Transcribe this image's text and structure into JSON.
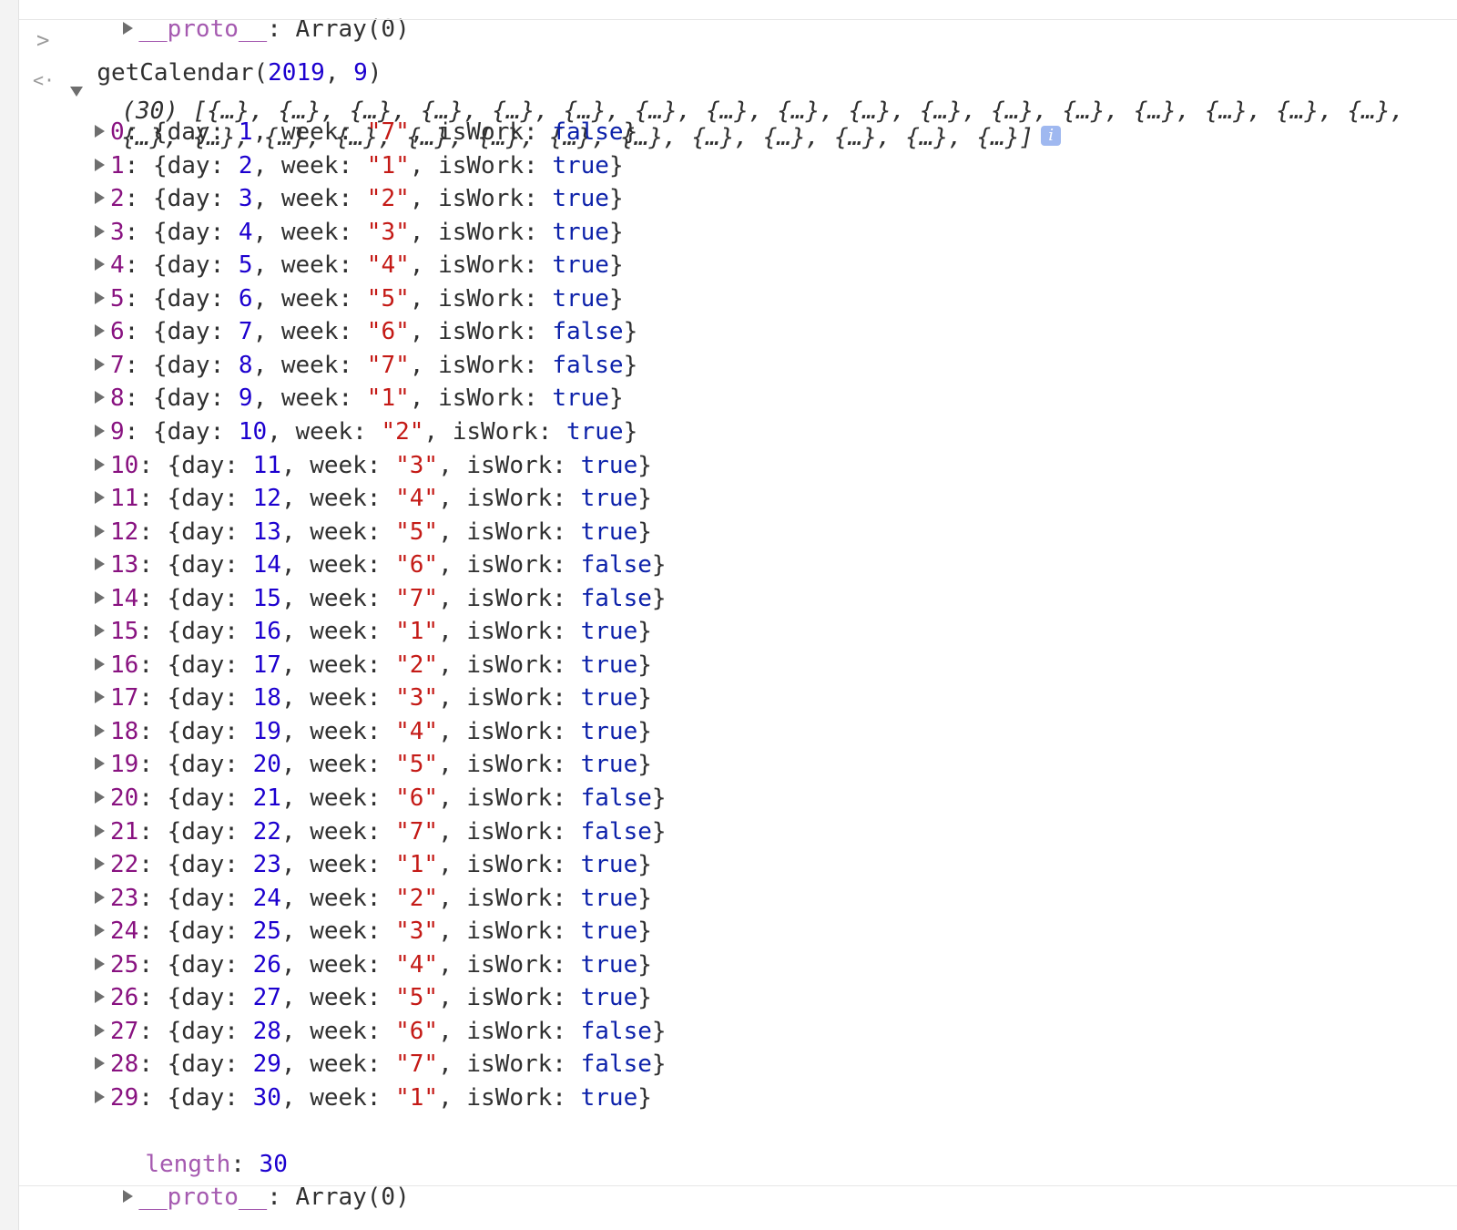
{
  "top_partial": {
    "key": "__proto__",
    "value": "Array(0)"
  },
  "command": {
    "func": "getCalendar(",
    "arg1": "2019",
    "comma": ", ",
    "arg2": "9",
    "close": ")"
  },
  "summary": {
    "count": "(30)",
    "line1": "[{…}, {…}, {…}, {…}, {…}, {…}, {…}, {…}, {…}, {…}, {…}, {…}, {…}, {…}, {…}, {…}, {…},",
    "line2": "{…}, {…}, {…}, {…}, {…}, {…}, {…}, {…}, {…}, {…}, {…}, {…}, {…}]",
    "info_icon": "info-icon"
  },
  "items": [
    {
      "index": "0",
      "day": "1",
      "week": "\"7\"",
      "isWork": "false"
    },
    {
      "index": "1",
      "day": "2",
      "week": "\"1\"",
      "isWork": "true"
    },
    {
      "index": "2",
      "day": "3",
      "week": "\"2\"",
      "isWork": "true"
    },
    {
      "index": "3",
      "day": "4",
      "week": "\"3\"",
      "isWork": "true"
    },
    {
      "index": "4",
      "day": "5",
      "week": "\"4\"",
      "isWork": "true"
    },
    {
      "index": "5",
      "day": "6",
      "week": "\"5\"",
      "isWork": "true"
    },
    {
      "index": "6",
      "day": "7",
      "week": "\"6\"",
      "isWork": "false"
    },
    {
      "index": "7",
      "day": "8",
      "week": "\"7\"",
      "isWork": "false"
    },
    {
      "index": "8",
      "day": "9",
      "week": "\"1\"",
      "isWork": "true"
    },
    {
      "index": "9",
      "day": "10",
      "week": "\"2\"",
      "isWork": "true"
    },
    {
      "index": "10",
      "day": "11",
      "week": "\"3\"",
      "isWork": "true"
    },
    {
      "index": "11",
      "day": "12",
      "week": "\"4\"",
      "isWork": "true"
    },
    {
      "index": "12",
      "day": "13",
      "week": "\"5\"",
      "isWork": "true"
    },
    {
      "index": "13",
      "day": "14",
      "week": "\"6\"",
      "isWork": "false"
    },
    {
      "index": "14",
      "day": "15",
      "week": "\"7\"",
      "isWork": "false"
    },
    {
      "index": "15",
      "day": "16",
      "week": "\"1\"",
      "isWork": "true"
    },
    {
      "index": "16",
      "day": "17",
      "week": "\"2\"",
      "isWork": "true"
    },
    {
      "index": "17",
      "day": "18",
      "week": "\"3\"",
      "isWork": "true"
    },
    {
      "index": "18",
      "day": "19",
      "week": "\"4\"",
      "isWork": "true"
    },
    {
      "index": "19",
      "day": "20",
      "week": "\"5\"",
      "isWork": "true"
    },
    {
      "index": "20",
      "day": "21",
      "week": "\"6\"",
      "isWork": "false"
    },
    {
      "index": "21",
      "day": "22",
      "week": "\"7\"",
      "isWork": "false"
    },
    {
      "index": "22",
      "day": "23",
      "week": "\"1\"",
      "isWork": "true"
    },
    {
      "index": "23",
      "day": "24",
      "week": "\"2\"",
      "isWork": "true"
    },
    {
      "index": "24",
      "day": "25",
      "week": "\"3\"",
      "isWork": "true"
    },
    {
      "index": "25",
      "day": "26",
      "week": "\"4\"",
      "isWork": "true"
    },
    {
      "index": "26",
      "day": "27",
      "week": "\"5\"",
      "isWork": "true"
    },
    {
      "index": "27",
      "day": "28",
      "week": "\"6\"",
      "isWork": "false"
    },
    {
      "index": "28",
      "day": "29",
      "week": "\"7\"",
      "isWork": "false"
    },
    {
      "index": "29",
      "day": "30",
      "week": "\"1\"",
      "isWork": "true"
    }
  ],
  "labels": {
    "day_key": "day: ",
    "week_key": "week: ",
    "iswork_key": "isWork: ",
    "open_brace": "{",
    "close_brace": "}",
    "comma": ", ",
    "index_sep": ": "
  },
  "length_row": {
    "key": "length",
    "sep": ": ",
    "value": "30"
  },
  "proto_row": {
    "key": "__proto__",
    "sep": ": ",
    "value": "Array(0)"
  },
  "glyphs": {
    "input_prompt": ">",
    "output_marker": "<·"
  }
}
